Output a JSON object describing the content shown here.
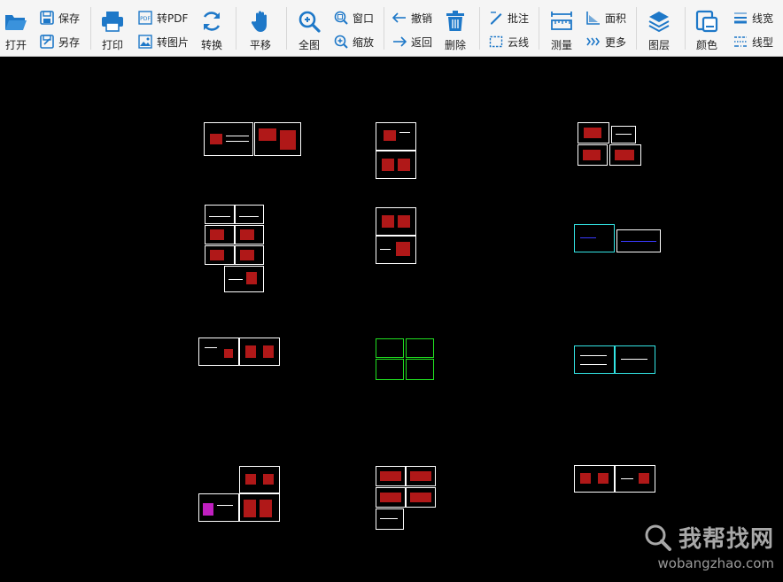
{
  "toolbar": {
    "open": "打开",
    "save": "保存",
    "save_as": "另存",
    "print": "打印",
    "to_pdf": "转PDF",
    "to_image": "转图片",
    "convert": "转换",
    "pan": "平移",
    "full_view": "全图",
    "window": "窗口",
    "zoom": "缩放",
    "undo": "撤销",
    "back": "返回",
    "delete": "删除",
    "annotate": "批注",
    "cloud_line": "云线",
    "measure": "测量",
    "area": "面积",
    "more": "更多",
    "layers": "图层",
    "color": "颜色",
    "line_width": "线宽",
    "line_type": "线型"
  },
  "colors": {
    "icon_blue": "#1e78c8",
    "sheet_border": "#ffffff",
    "block_red": "#b01818",
    "green_layer": "#21e021",
    "cyan_layer": "#33e6e6"
  },
  "watermark": {
    "text": "我帮找网",
    "url": "wobangzhao.com"
  }
}
